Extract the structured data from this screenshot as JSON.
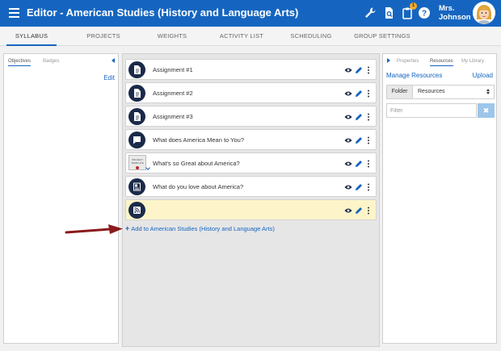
{
  "header": {
    "title": "Editor - American Studies (History and Language Arts)",
    "user_line1": "Mrs.",
    "user_line2": "Johnson",
    "notification_count": "1",
    "bg_color": "#1565c0"
  },
  "nav": {
    "tabs": [
      {
        "label": "SYLLABUS",
        "active": true
      },
      {
        "label": "PROJECTS"
      },
      {
        "label": "WEIGHTS"
      },
      {
        "label": "ACTIVITY LIST"
      },
      {
        "label": "SCHEDULING"
      },
      {
        "label": "GROUP SETTINGS"
      }
    ]
  },
  "left_panel": {
    "tabs": [
      "Objectives",
      "Badges"
    ],
    "edit_label": "Edit"
  },
  "items": [
    {
      "title": "Assignment #1",
      "icon": "document-icon"
    },
    {
      "title": "Assignment #2",
      "icon": "document-icon"
    },
    {
      "title": "Assignment #3",
      "icon": "document-icon"
    },
    {
      "title": "What does America Mean to You?",
      "icon": "discussion-icon"
    },
    {
      "title": "What's so Great about America?",
      "icon": "project-template-thumbnail",
      "thumb_lines": [
        "PROJECT",
        "TEMPLATE"
      ]
    },
    {
      "title": "What do you love about America?",
      "icon": "page-icon"
    },
    {
      "title": "",
      "icon": "rss-icon",
      "highlight": true
    }
  ],
  "add_link": "Add to American Studies (History and Language Arts)",
  "right_panel": {
    "tabs": [
      "Properties",
      "Resources",
      "My Library"
    ],
    "manage_label": "Manage Resources",
    "upload_label": "Upload",
    "folder_label": "Folder",
    "folder_value": "Resources",
    "filter_placeholder": "Filter",
    "clear_label": "✖"
  }
}
